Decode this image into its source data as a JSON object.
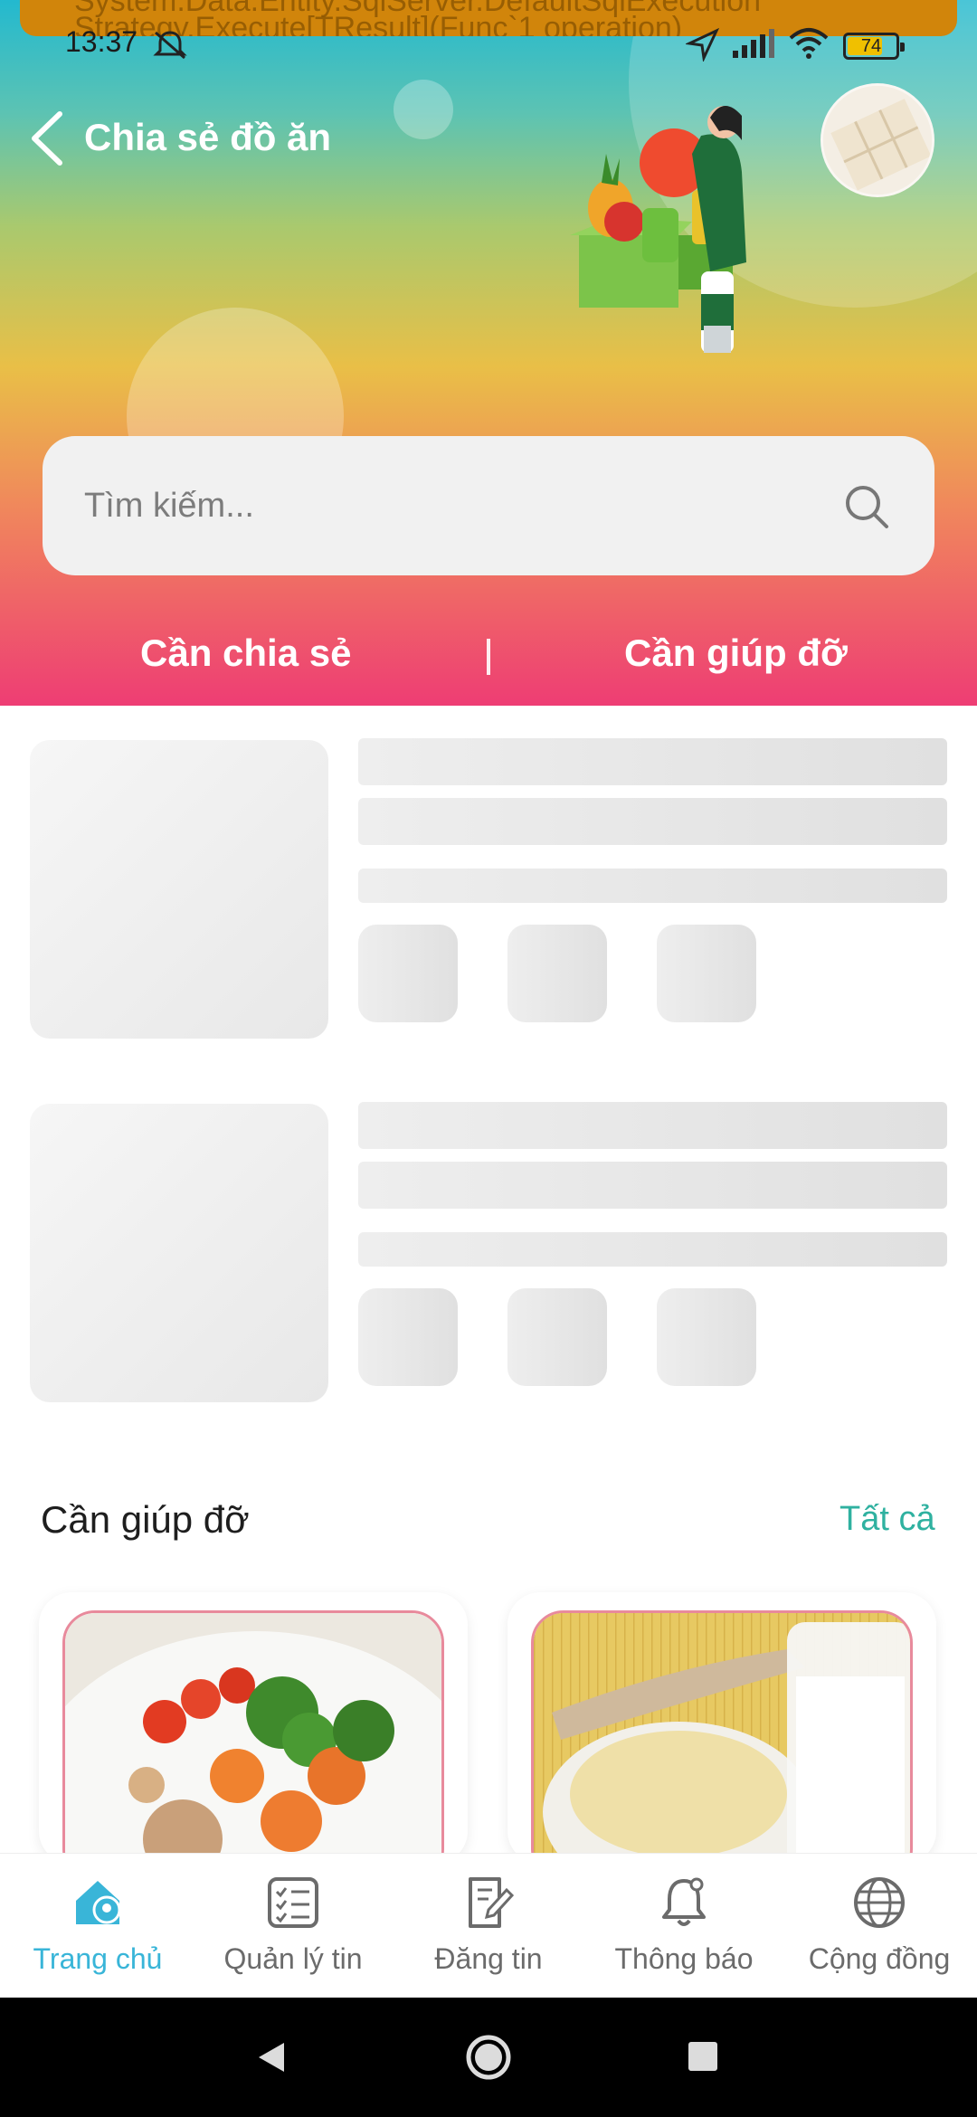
{
  "notification": {
    "text_line1": "System.Data.Entity.SqlServer.DefaultSqlExecution",
    "text_line2": "Strategy.Execute[TResult](Func`1 operation)"
  },
  "status_bar": {
    "time": "13:37",
    "battery": "74",
    "battery_level": 0.74
  },
  "header": {
    "title": "Chia sẻ đồ ăn",
    "back_icon": "chevron-left-icon"
  },
  "search": {
    "placeholder": "Tìm kiếm...",
    "icon": "search-icon"
  },
  "tabs": [
    {
      "label": "Cần chia sẻ"
    },
    {
      "label": "Cần giúp đỡ"
    }
  ],
  "section": {
    "title": "Cần giúp đỡ",
    "see_all": "Tất cả"
  },
  "bottom_nav": [
    {
      "label": "Trang chủ",
      "icon": "home-location-icon",
      "active": true
    },
    {
      "label": "Quản lý tin",
      "icon": "checklist-icon",
      "active": false
    },
    {
      "label": "Đăng tin",
      "icon": "edit-document-icon",
      "active": false
    },
    {
      "label": "Thông báo",
      "icon": "bell-icon",
      "active": false
    },
    {
      "label": "Cộng đồng",
      "icon": "globe-icon",
      "active": false
    }
  ],
  "colors": {
    "accent": "#2fb1a0",
    "active_nav": "#39b5d8",
    "header_top": "#23b9cf",
    "header_bottom": "#ee3d74"
  }
}
